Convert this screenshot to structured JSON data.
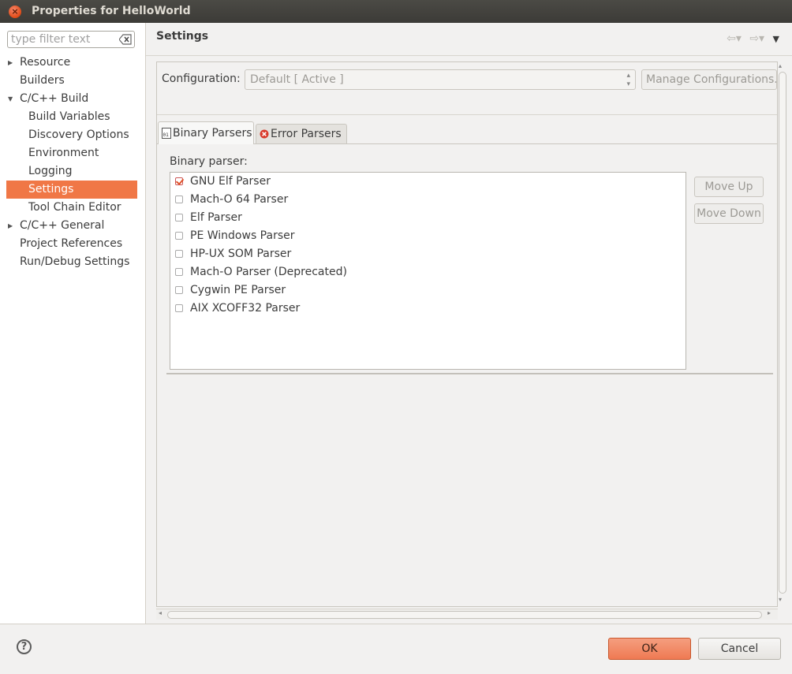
{
  "window": {
    "title": "Properties for HelloWorld"
  },
  "filter": {
    "placeholder": "type filter text"
  },
  "sidebar": {
    "items": [
      {
        "label": "Resource",
        "expandable": true,
        "expanded": false,
        "indent": 0
      },
      {
        "label": "Builders",
        "expandable": false,
        "indent": 0
      },
      {
        "label": "C/C++ Build",
        "expandable": true,
        "expanded": true,
        "indent": 0
      },
      {
        "label": "Build Variables",
        "expandable": false,
        "indent": 1
      },
      {
        "label": "Discovery Options",
        "expandable": false,
        "indent": 1
      },
      {
        "label": "Environment",
        "expandable": false,
        "indent": 1
      },
      {
        "label": "Logging",
        "expandable": false,
        "indent": 1
      },
      {
        "label": "Settings",
        "expandable": false,
        "indent": 1,
        "selected": true
      },
      {
        "label": "Tool Chain Editor",
        "expandable": false,
        "indent": 1
      },
      {
        "label": "C/C++ General",
        "expandable": true,
        "expanded": false,
        "indent": 0
      },
      {
        "label": "Project References",
        "expandable": false,
        "indent": 0
      },
      {
        "label": "Run/Debug Settings",
        "expandable": false,
        "indent": 0
      }
    ]
  },
  "page": {
    "title": "Settings"
  },
  "config": {
    "label": "Configuration:",
    "value": "Default  [ Active ]",
    "manage_label": "Manage Configurations..."
  },
  "tabs": [
    {
      "label": "Binary Parsers",
      "active": true,
      "icon": "binary-file-icon"
    },
    {
      "label": "Error Parsers",
      "active": false,
      "icon": "error-icon"
    }
  ],
  "binary": {
    "label": "Binary parser:",
    "parsers": [
      {
        "name": "GNU Elf Parser",
        "checked": true
      },
      {
        "name": "Mach-O 64 Parser",
        "checked": false
      },
      {
        "name": "Elf Parser",
        "checked": false
      },
      {
        "name": "PE Windows Parser",
        "checked": false
      },
      {
        "name": "HP-UX SOM Parser",
        "checked": false
      },
      {
        "name": "Mach-O Parser (Deprecated)",
        "checked": false
      },
      {
        "name": "Cygwin PE Parser",
        "checked": false
      },
      {
        "name": "AIX XCOFF32 Parser",
        "checked": false
      }
    ],
    "move_up": "Move Up",
    "move_down": "Move Down"
  },
  "buttons": {
    "help": "?",
    "ok": "OK",
    "cancel": "Cancel"
  },
  "colors": {
    "accent": "#f07746",
    "titlebar": "#3c3b37"
  }
}
